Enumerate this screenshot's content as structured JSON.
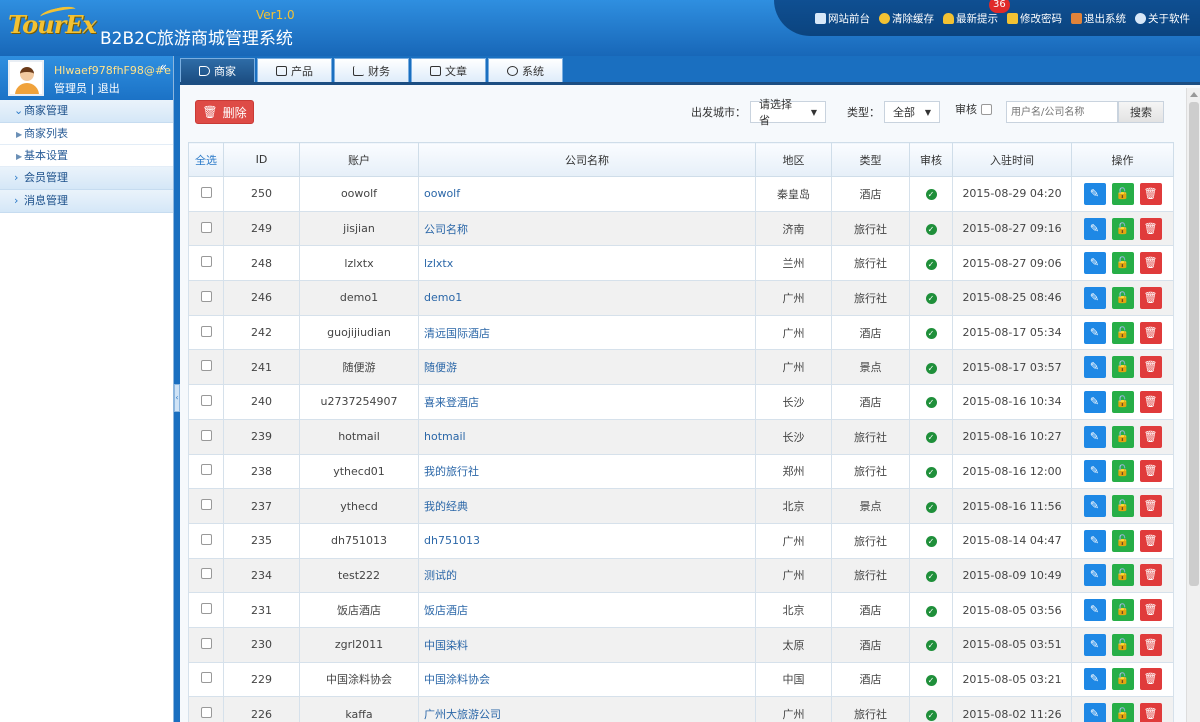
{
  "app": {
    "logo": "TourEx",
    "title": "B2B2C旅游商城管理系统",
    "version": "Ver1.0"
  },
  "topbar": {
    "links": [
      {
        "label": "网站前台",
        "icon": "monitor-icon"
      },
      {
        "label": "清除缓存",
        "icon": "refresh-icon"
      },
      {
        "label": "最新提示",
        "icon": "bell-icon",
        "badge": "36"
      },
      {
        "label": "修改密码",
        "icon": "lock-icon"
      },
      {
        "label": "退出系统",
        "icon": "exit-icon"
      },
      {
        "label": "关于软件",
        "icon": "info-icon"
      }
    ]
  },
  "user": {
    "name": "Hlwaef978fhF98@#e",
    "role_line": "管理员 | 退出"
  },
  "sidebar": {
    "groups": [
      {
        "label": "商家管理",
        "expanded": true,
        "items": [
          "商家列表",
          "基本设置"
        ]
      },
      {
        "label": "会员管理",
        "expanded": false,
        "items": []
      },
      {
        "label": "消息管理",
        "expanded": false,
        "items": []
      }
    ]
  },
  "tabs": [
    {
      "label": "商家",
      "icon": "tag-icon",
      "active": true
    },
    {
      "label": "产品",
      "icon": "cart-icon",
      "active": false
    },
    {
      "label": "财务",
      "icon": "chart-icon",
      "active": false
    },
    {
      "label": "文章",
      "icon": "document-icon",
      "active": false
    },
    {
      "label": "系统",
      "icon": "gear-icon",
      "active": false
    }
  ],
  "toolbar": {
    "delete_label": "删除",
    "city_label": "出发城市：",
    "city_value": "请选择省",
    "type_label": "类型：",
    "type_value": "全部",
    "audit_label": "审核",
    "search_placeholder": "用户名/公司名称",
    "search_button": "搜索"
  },
  "table": {
    "columns": [
      "全选",
      "ID",
      "账户",
      "公司名称",
      "地区",
      "类型",
      "审核",
      "入驻时间",
      "操作"
    ],
    "rows": [
      {
        "id": "250",
        "account": "oowolf",
        "company": "oowolf",
        "region": "秦皇岛",
        "type": "酒店",
        "time": "2015-08-29 04:20"
      },
      {
        "id": "249",
        "account": "jisjian",
        "company": "公司名称",
        "region": "济南",
        "type": "旅行社",
        "time": "2015-08-27 09:16"
      },
      {
        "id": "248",
        "account": "lzlxtx",
        "company": "lzlxtx",
        "region": "兰州",
        "type": "旅行社",
        "time": "2015-08-27 09:06"
      },
      {
        "id": "246",
        "account": "demo1",
        "company": "demo1",
        "region": "广州",
        "type": "旅行社",
        "time": "2015-08-25 08:46"
      },
      {
        "id": "242",
        "account": "guojijiudian",
        "company": "清远国际酒店",
        "region": "广州",
        "type": "酒店",
        "time": "2015-08-17 05:34"
      },
      {
        "id": "241",
        "account": "随便游",
        "company": "随便游",
        "region": "广州",
        "type": "景点",
        "time": "2015-08-17 03:57"
      },
      {
        "id": "240",
        "account": "u2737254907",
        "company": "喜来登酒店",
        "region": "长沙",
        "type": "酒店",
        "time": "2015-08-16 10:34"
      },
      {
        "id": "239",
        "account": "hotmail",
        "company": "hotmail",
        "region": "长沙",
        "type": "旅行社",
        "time": "2015-08-16 10:27"
      },
      {
        "id": "238",
        "account": "ythecd01",
        "company": "我的旅行社",
        "region": "郑州",
        "type": "旅行社",
        "time": "2015-08-16 12:00"
      },
      {
        "id": "237",
        "account": "ythecd",
        "company": "我的经典",
        "region": "北京",
        "type": "景点",
        "time": "2015-08-16 11:56"
      },
      {
        "id": "235",
        "account": "dh751013",
        "company": "dh751013",
        "region": "广州",
        "type": "旅行社",
        "time": "2015-08-14 04:47"
      },
      {
        "id": "234",
        "account": "test222",
        "company": "测试的",
        "region": "广州",
        "type": "旅行社",
        "time": "2015-08-09 10:49"
      },
      {
        "id": "231",
        "account": "饭店酒店",
        "company": "饭店酒店",
        "region": "北京",
        "type": "酒店",
        "time": "2015-08-05 03:56"
      },
      {
        "id": "230",
        "account": "zgrl2011",
        "company": "中国染料",
        "region": "太原",
        "type": "酒店",
        "time": "2015-08-05 03:51"
      },
      {
        "id": "229",
        "account": "中国涂料协会",
        "company": "中国涂料协会",
        "region": "中国",
        "type": "酒店",
        "time": "2015-08-05 03:21"
      },
      {
        "id": "226",
        "account": "kaffa",
        "company": "广州大旅游公司",
        "region": "广州",
        "type": "旅行社",
        "time": "2015-08-02 11:26"
      }
    ]
  },
  "colors": {
    "header": "#1f78c8",
    "danger": "#de4b46",
    "edit": "#1e88e5",
    "unlock": "#27ae47",
    "delete": "#e03b3b",
    "approved": "#1f8f3a"
  }
}
